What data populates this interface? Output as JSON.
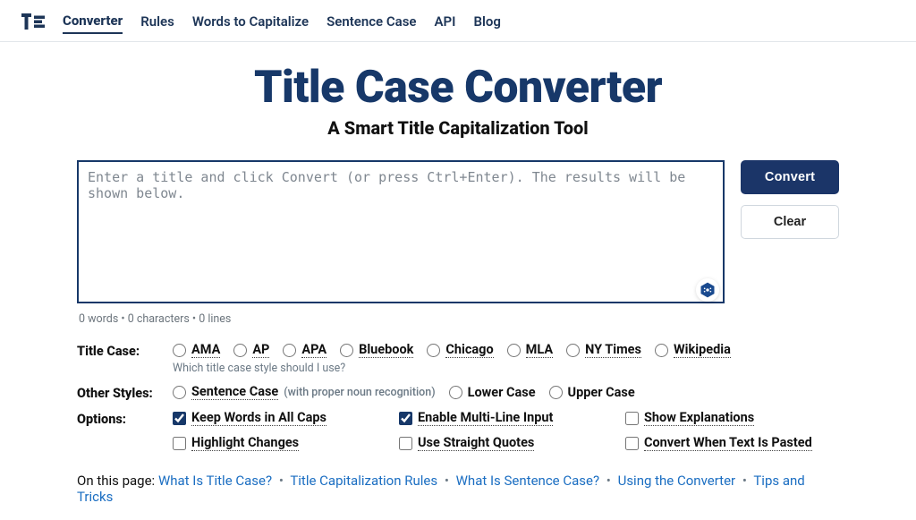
{
  "colors": {
    "navy": "#1b3568",
    "heading": "#173869",
    "link": "#1b6ec2"
  },
  "nav": {
    "items": [
      {
        "label": "Converter",
        "active": true
      },
      {
        "label": "Rules",
        "active": false
      },
      {
        "label": "Words to Capitalize",
        "active": false
      },
      {
        "label": "Sentence Case",
        "active": false
      },
      {
        "label": "API",
        "active": false
      },
      {
        "label": "Blog",
        "active": false
      }
    ]
  },
  "header": {
    "title": "Title Case Converter",
    "subtitle": "A Smart Title Capitalization Tool"
  },
  "editor": {
    "value": "",
    "placeholder": "Enter a title and click Convert (or press Ctrl+Enter). The results will be shown below."
  },
  "counts": {
    "words": 0,
    "characters": 0,
    "lines": 0,
    "text": "0 words • 0 characters • 0 lines"
  },
  "buttons": {
    "convert": "Convert",
    "clear": "Clear"
  },
  "groups": {
    "titleCase": {
      "label": "Title Case:",
      "helper": "Which title case style should I use?",
      "options": [
        {
          "key": "ama",
          "label": "AMA",
          "dotted": true
        },
        {
          "key": "ap",
          "label": "AP",
          "dotted": true
        },
        {
          "key": "apa",
          "label": "APA",
          "dotted": true
        },
        {
          "key": "bluebook",
          "label": "Bluebook",
          "dotted": true
        },
        {
          "key": "chicago",
          "label": "Chicago",
          "dotted": true
        },
        {
          "key": "mla",
          "label": "MLA",
          "dotted": true
        },
        {
          "key": "nytimes",
          "label": "NY Times",
          "dotted": true
        },
        {
          "key": "wikipedia",
          "label": "Wikipedia",
          "dotted": true
        }
      ]
    },
    "otherStyles": {
      "label": "Other Styles:",
      "options": [
        {
          "key": "sentence",
          "label": "Sentence Case",
          "dotted": true,
          "note": "(with proper noun recognition)"
        },
        {
          "key": "lower",
          "label": "Lower Case",
          "dotted": false
        },
        {
          "key": "upper",
          "label": "Upper Case",
          "dotted": false
        }
      ]
    },
    "options": {
      "label": "Options:",
      "checks": [
        {
          "key": "allcaps",
          "label": "Keep Words in All Caps",
          "checked": true,
          "dotted": true
        },
        {
          "key": "multiline",
          "label": "Enable Multi-Line Input",
          "checked": true,
          "dotted": true
        },
        {
          "key": "explain",
          "label": "Show Explanations",
          "checked": false,
          "dotted": true
        },
        {
          "key": "highlight",
          "label": "Highlight Changes",
          "checked": false,
          "dotted": true
        },
        {
          "key": "straight",
          "label": "Use Straight Quotes",
          "checked": false,
          "dotted": true
        },
        {
          "key": "onpaste",
          "label": "Convert When Text Is Pasted",
          "checked": false,
          "dotted": true
        }
      ]
    }
  },
  "onThisPage": {
    "lead": "On this page:",
    "links": [
      {
        "label": "What Is Title Case?"
      },
      {
        "label": "Title Capitalization Rules"
      },
      {
        "label": "What Is Sentence Case?"
      },
      {
        "label": "Using the Converter"
      },
      {
        "label": "Tips and Tricks"
      }
    ]
  }
}
